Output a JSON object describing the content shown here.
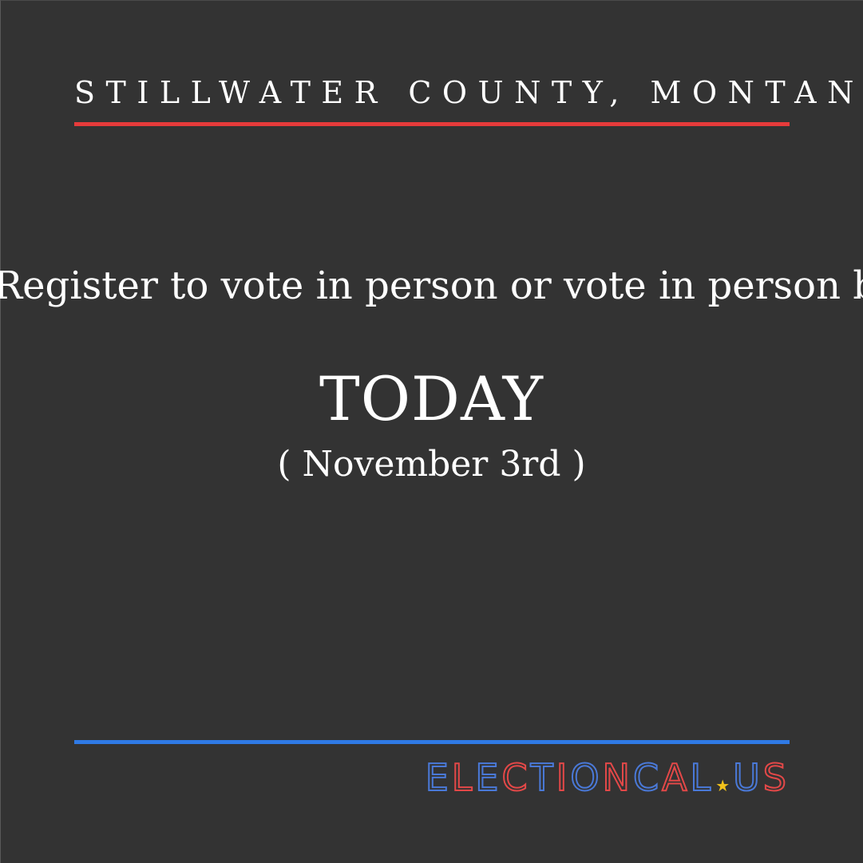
{
  "header": {
    "region": "STILLWATER COUNTY, MONTANA"
  },
  "body": {
    "message": "Register to vote in person or vote in person by",
    "headline": "TODAY",
    "date": "( November 3rd )"
  },
  "footer": {
    "brand_letters": [
      "E",
      "L",
      "E",
      "C",
      "T",
      "I",
      "O",
      "N",
      "C",
      "A",
      "L"
    ],
    "brand_suffix_letters": [
      "U",
      "S"
    ],
    "brand_star": "★",
    "colors": {
      "background": "#333333",
      "accent_red": "#e63b3b",
      "accent_blue": "#2f7ae5",
      "star_yellow": "#f2c21b"
    }
  }
}
